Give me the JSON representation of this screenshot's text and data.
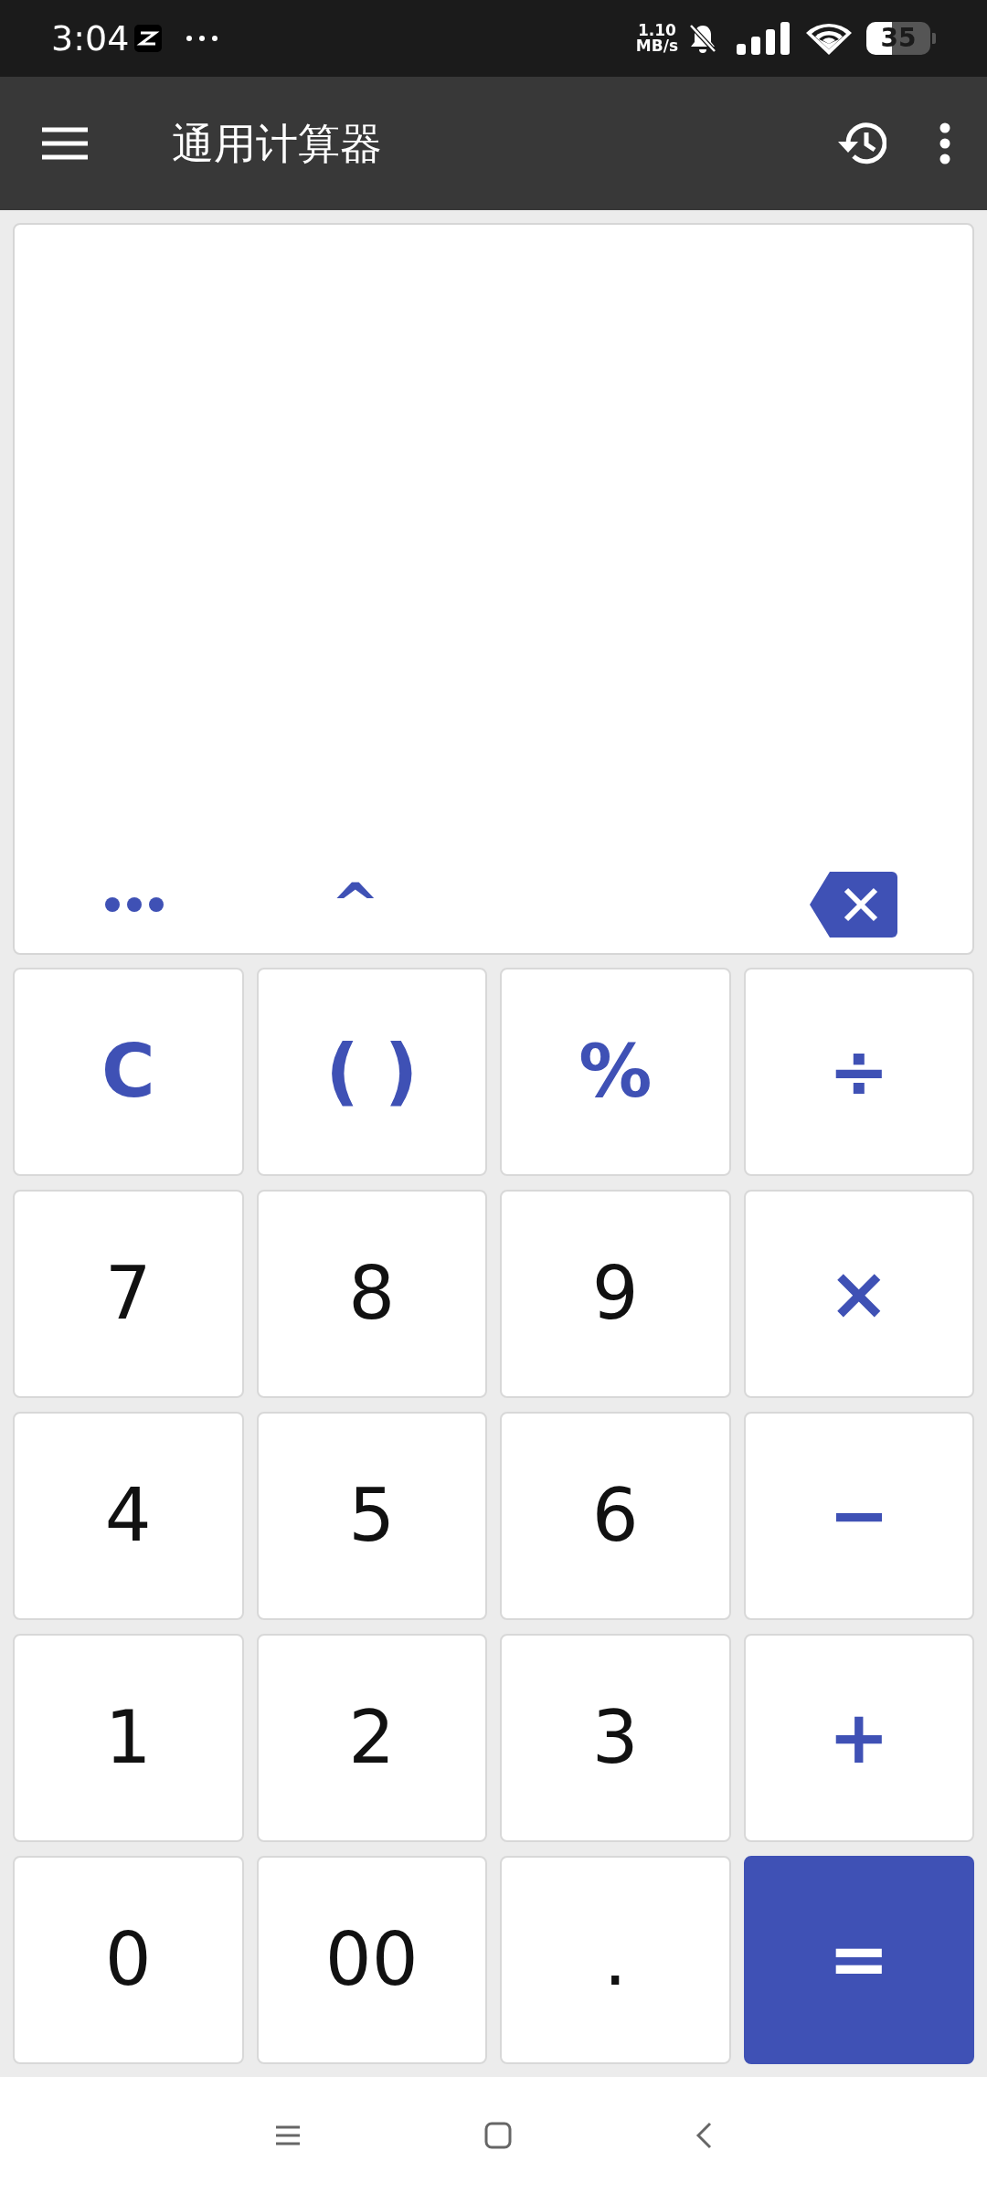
{
  "status_bar": {
    "time": "3:04",
    "net_speed": "1.10",
    "net_unit": "MB/s",
    "battery": "35"
  },
  "app_bar": {
    "title": "通用计算器"
  },
  "display": {
    "power_key": "^"
  },
  "keys": [
    {
      "label": "C",
      "kind": "func"
    },
    {
      "label": "( )",
      "kind": "func"
    },
    {
      "label": "%",
      "kind": "func"
    },
    {
      "label": "÷",
      "kind": "op"
    },
    {
      "label": "7",
      "kind": "digit"
    },
    {
      "label": "8",
      "kind": "digit"
    },
    {
      "label": "9",
      "kind": "digit"
    },
    {
      "label": "×",
      "kind": "op"
    },
    {
      "label": "4",
      "kind": "digit"
    },
    {
      "label": "5",
      "kind": "digit"
    },
    {
      "label": "6",
      "kind": "digit"
    },
    {
      "label": "−",
      "kind": "op"
    },
    {
      "label": "1",
      "kind": "digit"
    },
    {
      "label": "2",
      "kind": "digit"
    },
    {
      "label": "3",
      "kind": "digit"
    },
    {
      "label": "+",
      "kind": "op"
    },
    {
      "label": "0",
      "kind": "digit"
    },
    {
      "label": "00",
      "kind": "digit"
    },
    {
      "label": ".",
      "kind": "digit"
    },
    {
      "label": "=",
      "kind": "equals"
    }
  ]
}
